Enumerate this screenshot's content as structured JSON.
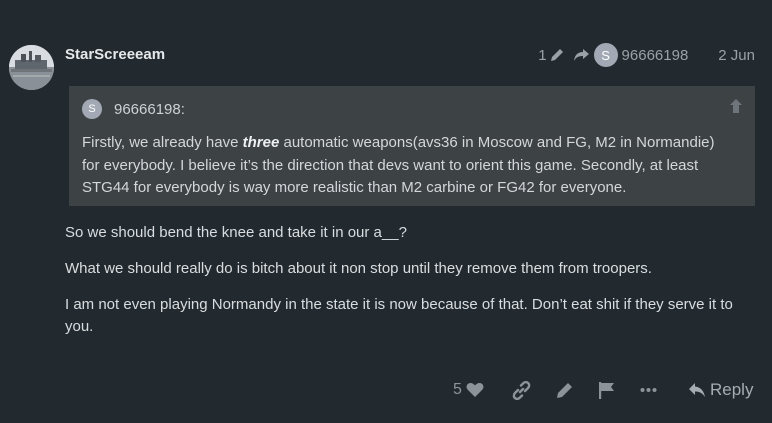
{
  "post": {
    "username": "StarScreeeam",
    "edit_count": "1",
    "reply_to_avatar_letter": "S",
    "reply_to_user": "96666198",
    "date": "2 Jun"
  },
  "quote": {
    "avatar_letter": "S",
    "author": "96666198:",
    "text_before": "Firstly, we already have ",
    "text_emphasis": "three",
    "text_after": " automatic weapons(avs36 in Moscow and FG, M2 in Normandie) for everybody. I believe it’s the direction that devs want to orient this game. Secondly, at least STG44 for everybody is way more realistic than M2 carbine or FG42 for everyone."
  },
  "paragraphs": [
    "So we should bend the knee and take it in our a__?",
    "What we should really do is bitch about it non stop until they remove them from troopers.",
    "I am not even playing Normandy in the state it is now because of that. Don’t eat shit if they serve it to you."
  ],
  "actions": {
    "like_count": "5",
    "reply_label": "Reply"
  },
  "colors": {
    "background": "#232a2f",
    "quote_background": "#3d4245",
    "muted": "#8c9499",
    "user_avatar": "#a3a9b4"
  },
  "icons": {
    "edit": "pencil-icon",
    "reply_to": "share-arrow-icon",
    "quote_expand": "arrow-up-icon",
    "like": "heart-icon",
    "link": "link-icon",
    "edit_action": "pencil-icon",
    "flag": "flag-icon",
    "more": "ellipsis-icon",
    "reply": "reply-icon"
  }
}
